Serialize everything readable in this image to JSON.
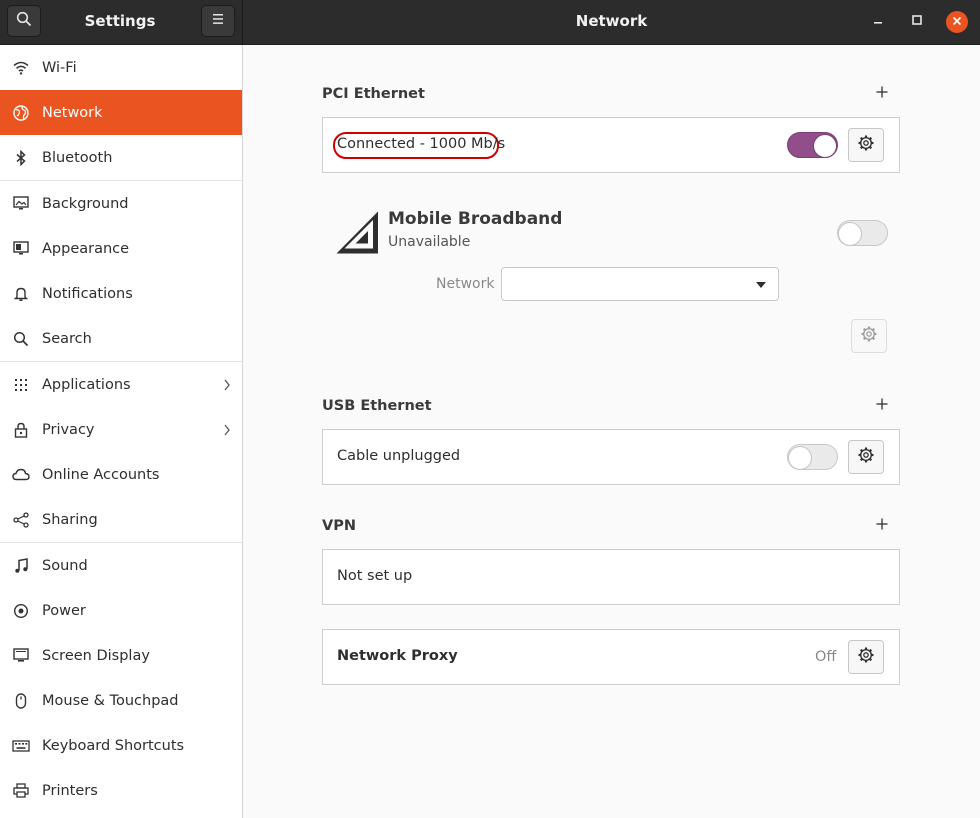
{
  "header": {
    "left_title": "Settings",
    "main_title": "Network",
    "icons": [
      "search-icon",
      "hamburger-menu-icon",
      "minimize-icon",
      "maximize-icon",
      "close-icon"
    ],
    "close_color": "#e95420"
  },
  "sidebar": {
    "accent": "#e95420",
    "items": [
      {
        "label": "Wi-Fi",
        "icon": "wifi-icon"
      },
      {
        "label": "Network",
        "icon": "network-icon",
        "active": true
      },
      {
        "label": "Bluetooth",
        "icon": "bluetooth-icon"
      },
      {
        "label": "Background",
        "icon": "background-icon"
      },
      {
        "label": "Appearance",
        "icon": "appearance-icon"
      },
      {
        "label": "Notifications",
        "icon": "bell-icon"
      },
      {
        "label": "Search",
        "icon": "search-icon"
      },
      {
        "label": "Applications",
        "icon": "grid-icon",
        "chevron": true
      },
      {
        "label": "Privacy",
        "icon": "lock-icon",
        "chevron": true
      },
      {
        "label": "Online Accounts",
        "icon": "cloud-icon"
      },
      {
        "label": "Sharing",
        "icon": "share-icon"
      },
      {
        "label": "Sound",
        "icon": "music-note-icon"
      },
      {
        "label": "Power",
        "icon": "power-icon"
      },
      {
        "label": "Screen Display",
        "icon": "display-icon"
      },
      {
        "label": "Mouse & Touchpad",
        "icon": "mouse-icon"
      },
      {
        "label": "Keyboard Shortcuts",
        "icon": "keyboard-icon"
      },
      {
        "label": "Printers",
        "icon": "printer-icon"
      }
    ]
  },
  "main": {
    "pci": {
      "title": "PCI Ethernet",
      "status": "Connected - 1000 Mb/s",
      "enabled": true,
      "switch_color": "#924d8b"
    },
    "mobile": {
      "title": "Mobile Broadband",
      "subtitle": "Unavailable",
      "network_label": "Network",
      "network_value": "",
      "enabled": false
    },
    "usb": {
      "title": "USB Ethernet",
      "status": "Cable unplugged",
      "enabled": false
    },
    "vpn": {
      "title": "VPN",
      "status": "Not set up"
    },
    "proxy": {
      "title": "Network Proxy",
      "value": "Off"
    }
  }
}
